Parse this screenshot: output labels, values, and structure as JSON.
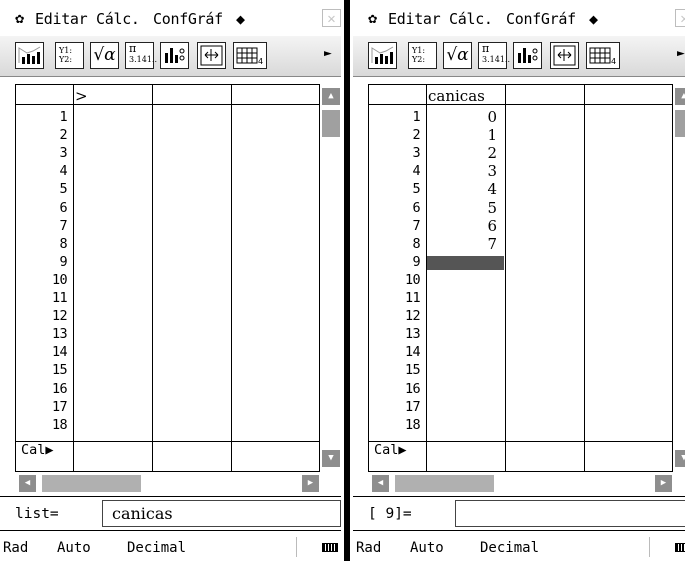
{
  "screens": [
    {
      "menu": {
        "gear": "✿",
        "edit": "Editar",
        "calc": "Cálc.",
        "confgraf": "ConfGráf",
        "diamond": "◆",
        "close": "✕"
      },
      "toolbar": {
        "y1": "Y1:",
        "y2": "Y2:",
        "sqrt": "√α",
        "pi": "π",
        "pi_val": "3.141..",
        "more": "►"
      },
      "column_header": ">",
      "column_values": [],
      "row_numbers": [
        "1",
        "2",
        "3",
        "4",
        "5",
        "6",
        "7",
        "8",
        "9",
        "10",
        "11",
        "12",
        "13",
        "14",
        "15",
        "16",
        "17",
        "18"
      ],
      "cal_label": "Cal▶",
      "entry_label": "list=",
      "entry_value": "canicas",
      "status": {
        "angle": "Rad",
        "mode": "Auto",
        "format": "Decimal"
      }
    },
    {
      "menu": {
        "gear": "✿",
        "edit": "Editar",
        "calc": "Cálc.",
        "confgraf": "ConfGráf",
        "diamond": "◆",
        "close": "✕"
      },
      "toolbar": {
        "y1": "Y1:",
        "y2": "Y2:",
        "sqrt": "√α",
        "pi": "π",
        "pi_val": "3.141..",
        "more": "►"
      },
      "column_header": "canicas",
      "column_values": [
        "0",
        "1",
        "2",
        "3",
        "4",
        "5",
        "6",
        "7"
      ],
      "row_numbers": [
        "1",
        "2",
        "3",
        "4",
        "5",
        "6",
        "7",
        "8",
        "9",
        "10",
        "11",
        "12",
        "13",
        "14",
        "15",
        "16",
        "17",
        "18"
      ],
      "cal_label": "Cal▶",
      "entry_label": "[  9]=",
      "entry_value": "",
      "status": {
        "angle": "Rad",
        "mode": "Auto",
        "format": "Decimal"
      }
    }
  ]
}
